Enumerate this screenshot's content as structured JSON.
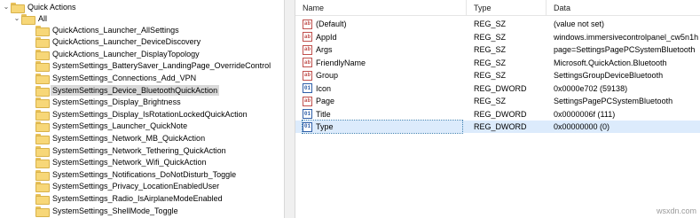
{
  "tree": {
    "root_label": "Quick Actions",
    "child_label": "All",
    "items": [
      "QuickActions_Launcher_AllSettings",
      "QuickActions_Launcher_DeviceDiscovery",
      "QuickActions_Launcher_DisplayTopology",
      "SystemSettings_BatterySaver_LandingPage_OverrideControl",
      "SystemSettings_Connections_Add_VPN",
      "SystemSettings_Device_BluetoothQuickAction",
      "SystemSettings_Display_Brightness",
      "SystemSettings_Display_IsRotationLockedQuickAction",
      "SystemSettings_Launcher_QuickNote",
      "SystemSettings_Network_MB_QuickAction",
      "SystemSettings_Network_Tethering_QuickAction",
      "SystemSettings_Network_Wifi_QuickAction",
      "SystemSettings_Notifications_DoNotDisturb_Toggle",
      "SystemSettings_Privacy_LocationEnabledUser",
      "SystemSettings_Radio_IsAirplaneModeEnabled",
      "SystemSettings_ShellMode_Toggle"
    ],
    "selected_index": 5
  },
  "columns": {
    "name": "Name",
    "type": "Type",
    "data": "Data"
  },
  "values": [
    {
      "name": "(Default)",
      "type": "REG_SZ",
      "data": "(value not set)",
      "icon": "string-value-icon"
    },
    {
      "name": "AppId",
      "type": "REG_SZ",
      "data": "windows.immersivecontrolpanel_cw5n1h",
      "icon": "string-value-icon"
    },
    {
      "name": "Args",
      "type": "REG_SZ",
      "data": "page=SettingsPagePCSystemBluetooth",
      "icon": "string-value-icon"
    },
    {
      "name": "FriendlyName",
      "type": "REG_SZ",
      "data": "Microsoft.QuickAction.Bluetooth",
      "icon": "string-value-icon"
    },
    {
      "name": "Group",
      "type": "REG_SZ",
      "data": "SettingsGroupDeviceBluetooth",
      "icon": "string-value-icon"
    },
    {
      "name": "Icon",
      "type": "REG_DWORD",
      "data": "0x0000e702 (59138)",
      "icon": "dword-value-icon"
    },
    {
      "name": "Page",
      "type": "REG_SZ",
      "data": "SettingsPagePCSystemBluetooth",
      "icon": "string-value-icon"
    },
    {
      "name": "Title",
      "type": "REG_DWORD",
      "data": "0x0000006f (111)",
      "icon": "dword-value-icon"
    },
    {
      "name": "Type",
      "type": "REG_DWORD",
      "data": "0x00000000 (0)",
      "icon": "dword-value-icon"
    }
  ],
  "selected_value_index": 8,
  "watermark": "wsxdn.com"
}
